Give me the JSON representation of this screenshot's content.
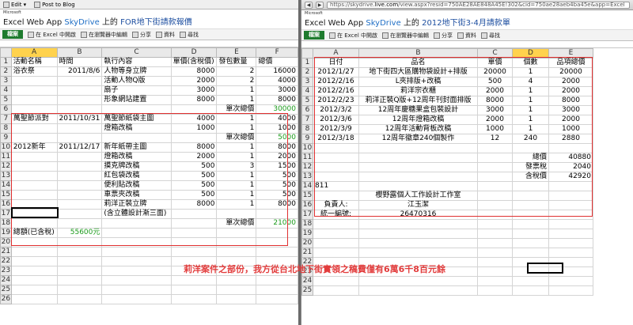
{
  "left": {
    "menu": {
      "edit": "Edit",
      "post": "Post to Blog"
    },
    "ms": "Microsoft",
    "app": "Excel Web App",
    "skydrive": "SkyDrive",
    "on": "上的",
    "filename": "FOR地下街請款報價",
    "ribbon": {
      "file": "檔案",
      "open_excel": "在 Excel 中開啟",
      "edit_browser": "在瀏覽器中編輯",
      "share": "分享",
      "data": "資料",
      "find": "尋找"
    },
    "cols": [
      "A",
      "B",
      "C",
      "D",
      "E",
      "F"
    ],
    "rows": [
      {
        "n": "1",
        "a": "活動名稱",
        "b": "時間",
        "c": "執行內容",
        "d": "單價(含稅價)",
        "e": "發包數量",
        "f": "總價"
      },
      {
        "n": "2",
        "a": "浴衣祭",
        "b": "2011/8/6",
        "c": "人物等身立牌",
        "d": "8000",
        "e": "2",
        "f": "16000"
      },
      {
        "n": "3",
        "a": "",
        "b": "",
        "c": "活動人物Q版",
        "d": "2000",
        "e": "2",
        "f": "4000"
      },
      {
        "n": "4",
        "a": "",
        "b": "",
        "c": "扇子",
        "d": "3000",
        "e": "1",
        "f": "3000"
      },
      {
        "n": "5",
        "a": "",
        "b": "",
        "c": "形象網站建置",
        "d": "8000",
        "e": "1",
        "f": "8000"
      },
      {
        "n": "6",
        "a": "",
        "b": "",
        "c": "",
        "d": "",
        "e": "單次總價",
        "f": "30000"
      },
      {
        "n": "7",
        "a": "萬聖節派對",
        "b": "2011/10/31",
        "c": "萬聖節紙袋主圖",
        "d": "4000",
        "e": "1",
        "f": "4000"
      },
      {
        "n": "8",
        "a": "",
        "b": "",
        "c": "燈箱改稿",
        "d": "1000",
        "e": "1",
        "f": "1000"
      },
      {
        "n": "9",
        "a": "",
        "b": "",
        "c": "",
        "d": "",
        "e": "單次總價",
        "f": "5000"
      },
      {
        "n": "10",
        "a": "2012新年",
        "b": "2011/12/17",
        "c": "新年紙帶主圖",
        "d": "8000",
        "e": "1",
        "f": "8000"
      },
      {
        "n": "11",
        "a": "",
        "b": "",
        "c": "燈箱改稿",
        "d": "2000",
        "e": "1",
        "f": "2000"
      },
      {
        "n": "12",
        "a": "",
        "b": "",
        "c": "摸克牌改稿",
        "d": "500",
        "e": "3",
        "f": "1500"
      },
      {
        "n": "13",
        "a": "",
        "b": "",
        "c": "紅包袋改稿",
        "d": "500",
        "e": "1",
        "f": "500"
      },
      {
        "n": "14",
        "a": "",
        "b": "",
        "c": "便利貼改稿",
        "d": "500",
        "e": "1",
        "f": "500"
      },
      {
        "n": "15",
        "a": "",
        "b": "",
        "c": "車票夾改稿",
        "d": "500",
        "e": "1",
        "f": "500"
      },
      {
        "n": "16",
        "a": "",
        "b": "",
        "c": "莉洋正裝立牌",
        "d": "8000",
        "e": "1",
        "f": "8000"
      },
      {
        "n": "17",
        "a": "",
        "b": "",
        "c": "(含立體設計漸三面)",
        "d": "",
        "e": "",
        "f": ""
      },
      {
        "n": "18",
        "a": "",
        "b": "",
        "c": "",
        "d": "",
        "e": "單次總價",
        "f": "21000"
      },
      {
        "n": "19",
        "a": "總額(已含稅)",
        "b": "55600元",
        "c": "",
        "d": "",
        "e": "",
        "f": ""
      },
      {
        "n": "20",
        "a": "",
        "b": "",
        "c": "",
        "d": "",
        "e": "",
        "f": ""
      },
      {
        "n": "21",
        "a": "",
        "b": "",
        "c": "",
        "d": "",
        "e": "",
        "f": ""
      },
      {
        "n": "22",
        "a": "",
        "b": "",
        "c": "",
        "d": "",
        "e": "",
        "f": ""
      },
      {
        "n": "23",
        "a": "",
        "b": "",
        "c": "",
        "d": "",
        "e": "",
        "f": ""
      },
      {
        "n": "24",
        "a": "",
        "b": "",
        "c": "",
        "d": "",
        "e": "",
        "f": ""
      },
      {
        "n": "25",
        "a": "",
        "b": "",
        "c": "",
        "d": "",
        "e": "",
        "f": ""
      },
      {
        "n": "26",
        "a": "",
        "b": "",
        "c": "",
        "d": "",
        "e": "",
        "f": ""
      }
    ]
  },
  "right": {
    "url_pre": "https://skydrive.",
    "url_host": "live.com",
    "url_post": "/view.aspx?resid=750AE28AE848A45E!302&cid=750ae28aeb4ba45e&app=Excel",
    "ms": "Microsoft",
    "app": "Excel Web App",
    "skydrive": "SkyDrive",
    "on": "上的",
    "filename": "2012地下街3-4月請款單",
    "ribbon": {
      "file": "檔案",
      "open_excel": "在 Excel 中開啟",
      "edit_browser": "在瀏覽器中編輯",
      "share": "分享",
      "data": "資料",
      "find": "尋找"
    },
    "cols": [
      "A",
      "B",
      "C",
      "D",
      "E"
    ],
    "rows": [
      {
        "n": "1",
        "a": "日付",
        "b": "品名",
        "c": "單價",
        "d": "個數",
        "e": "品項總價"
      },
      {
        "n": "2",
        "a": "2012/1/27",
        "b": "地下街四大區購物袋設計+排版",
        "c": "20000",
        "d": "1",
        "e": "20000"
      },
      {
        "n": "3",
        "a": "2012/2/16",
        "b": "L夾排版+改稿",
        "c": "500",
        "d": "4",
        "e": "2000"
      },
      {
        "n": "4",
        "a": "2012/2/16",
        "b": "莉洋宗衣櫃",
        "c": "2000",
        "d": "1",
        "e": "2000"
      },
      {
        "n": "5",
        "a": "2012/2/23",
        "b": "莉洋正裝Q版+12周年刊封面排版",
        "c": "8000",
        "d": "1",
        "e": "8000"
      },
      {
        "n": "6",
        "a": "2012/3/2",
        "b": "12周年慶糖果盒包裝設計",
        "c": "3000",
        "d": "1",
        "e": "3000"
      },
      {
        "n": "7",
        "a": "2012/3/6",
        "b": "12周年燈箱改稿",
        "c": "2000",
        "d": "1",
        "e": "2000"
      },
      {
        "n": "8",
        "a": "2012/3/9",
        "b": "12周年活動背板改稿",
        "c": "1000",
        "d": "1",
        "e": "1000"
      },
      {
        "n": "9",
        "a": "2012/3/18",
        "b": "12周年徽章240個製作",
        "c": "12",
        "d": "240",
        "e": "2880"
      },
      {
        "n": "10",
        "a": "",
        "b": "",
        "c": "",
        "d": "",
        "e": ""
      },
      {
        "n": "11",
        "a": "",
        "b": "",
        "c": "",
        "d": "總價",
        "e": "40880"
      },
      {
        "n": "12",
        "a": "",
        "b": "",
        "c": "",
        "d": "發票稅",
        "e": "2040"
      },
      {
        "n": "13",
        "a": "",
        "b": "",
        "c": "",
        "d": "含稅價",
        "e": "42920"
      },
      {
        "n": "14",
        "a": "811",
        "b": "",
        "c": "",
        "d": "",
        "e": ""
      },
      {
        "n": "15",
        "a": "",
        "b": "櫻野露個人工作設計工作室",
        "c": "",
        "d": "",
        "e": ""
      },
      {
        "n": "16",
        "a": "負責人:",
        "b": "江玉潔",
        "c": "",
        "d": "",
        "e": ""
      },
      {
        "n": "17",
        "a": "統一編號:",
        "b": "26470316",
        "c": "",
        "d": "",
        "e": ""
      },
      {
        "n": "18",
        "a": "",
        "b": "",
        "c": "",
        "d": "",
        "e": ""
      },
      {
        "n": "19",
        "a": "",
        "b": "",
        "c": "",
        "d": "",
        "e": ""
      },
      {
        "n": "20",
        "a": "",
        "b": "",
        "c": "",
        "d": "",
        "e": ""
      },
      {
        "n": "21",
        "a": "",
        "b": "",
        "c": "",
        "d": "",
        "e": ""
      },
      {
        "n": "22",
        "a": "",
        "b": "",
        "c": "",
        "d": "",
        "e": ""
      },
      {
        "n": "23",
        "a": "",
        "b": "",
        "c": "",
        "d": "",
        "e": ""
      },
      {
        "n": "24",
        "a": "",
        "b": "",
        "c": "",
        "d": "",
        "e": ""
      },
      {
        "n": "25",
        "a": "",
        "b": "",
        "c": "",
        "d": "",
        "e": ""
      }
    ]
  },
  "caption": "莉洋案件之部份，我方從台北地下街實領之稿費僅有6萬6千8百元餘",
  "colors": {
    "red": "#e23c3c",
    "green": "#1b9b1b",
    "selected_col": "#ffd24d",
    "file_tab": "#1e7b2e"
  }
}
